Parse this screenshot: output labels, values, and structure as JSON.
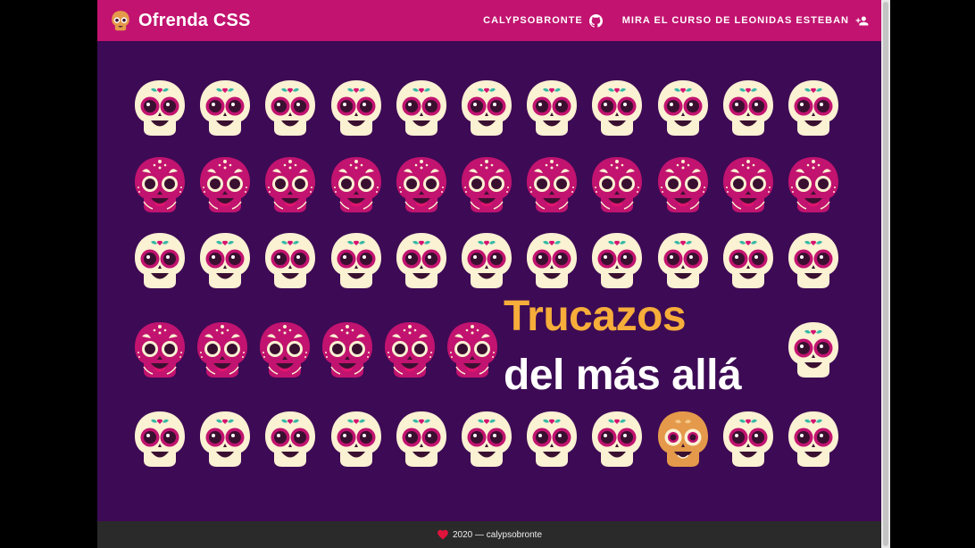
{
  "navbar": {
    "title": "Ofrenda CSS",
    "links": [
      {
        "label": "CALYPSOBRONTE",
        "icon": "github-icon"
      },
      {
        "label": "MIRA EL CURSO DE LEONIDAS ESTEBAN",
        "icon": "person-add-icon"
      }
    ]
  },
  "hero": {
    "line1": "Trucazos",
    "line2": "del más allá"
  },
  "footer": {
    "text": "2020 — calypsobronte",
    "icon": "heart-icon"
  },
  "colors": {
    "background": "#3d0a55",
    "navbar": "#c1136f",
    "hero_accent": "#f6ad3a",
    "skull_cream": "#fbf1d3",
    "skull_pink": "#c1136f",
    "skull_orange": "#e49a4a",
    "footer": "#2a2a2a"
  },
  "skull_grid": {
    "rows": [
      [
        "cream",
        "cream",
        "cream",
        "cream",
        "cream",
        "cream",
        "cream",
        "cream",
        "cream",
        "cream",
        "cream"
      ],
      [
        "pink",
        "pink",
        "pink",
        "pink",
        "pink",
        "pink",
        "pink",
        "pink",
        "pink",
        "pink",
        "pink"
      ],
      [
        "cream",
        "cream",
        "cream",
        "cream",
        "cream",
        "cream",
        "cream",
        "cream",
        "cream",
        "cream",
        "cream"
      ],
      [
        "pink",
        "pink",
        "pink",
        "pink",
        "pink",
        "pink",
        null,
        null,
        null,
        null,
        "cream"
      ],
      [
        "cream",
        "cream",
        "cream",
        "cream",
        "cream",
        "cream",
        "cream",
        "cream",
        "orange",
        "cream",
        "cream"
      ]
    ]
  }
}
